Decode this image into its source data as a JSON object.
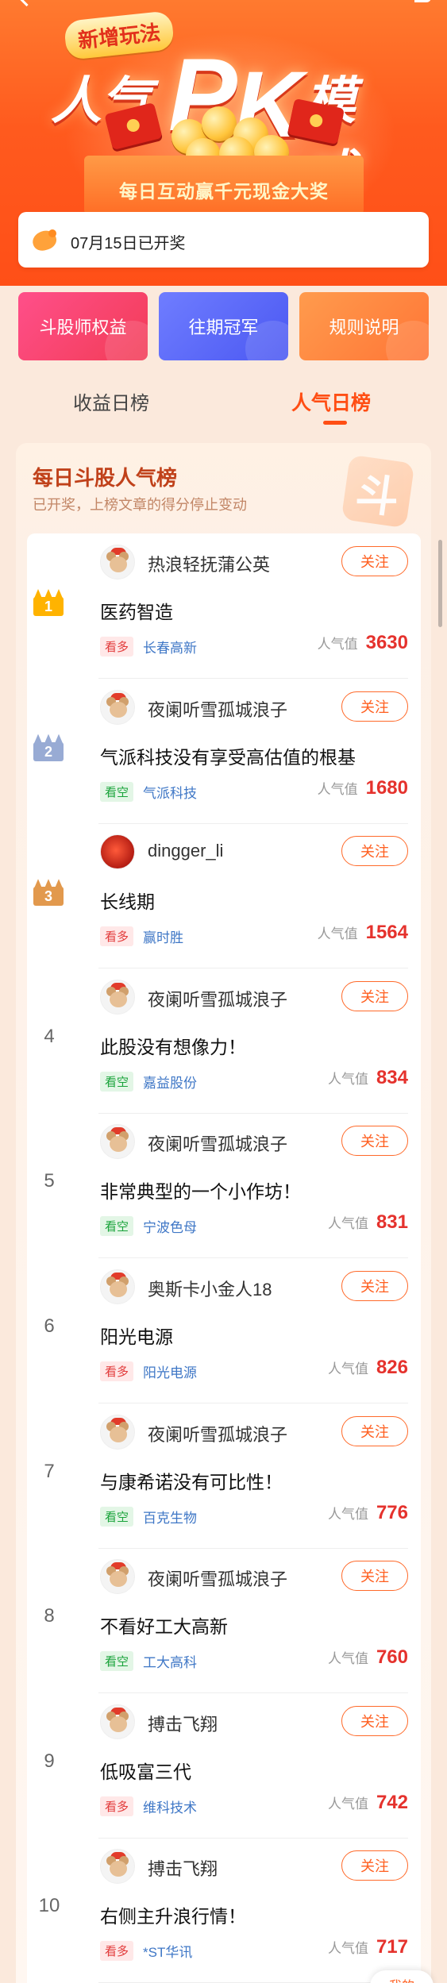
{
  "banner": {
    "badge": "新增玩法",
    "title_pre": "人气",
    "title_p": "P",
    "title_k": "K",
    "title_post": "模式",
    "slogan": "每日互动赢千元现金大奖"
  },
  "notice": {
    "text": "07月15日已开奖",
    "icon": "piggy-icon"
  },
  "buttons": [
    {
      "label": "斗股师权益",
      "color": "#f23c56"
    },
    {
      "label": "往期冠军",
      "color": "#4b58f2"
    },
    {
      "label": "规则说明",
      "color": "#ff7536"
    }
  ],
  "tabs": [
    {
      "label": "收益日榜",
      "active": false
    },
    {
      "label": "人气日榜",
      "active": true
    }
  ],
  "card": {
    "title": "每日斗股人气榜",
    "subtitle": "已开奖，上榜文章的得分停止变动",
    "mark": "斗"
  },
  "list": [
    {
      "rank": "1",
      "author": "热浪轻抚蒲公英",
      "follow": "关注",
      "title": "医药智造",
      "tag": "看多",
      "stock": "长春高新",
      "pop_label": "人气值",
      "pop": "3630"
    },
    {
      "rank": "2",
      "author": "夜阑听雪孤城浪子",
      "follow": "关注",
      "title": "气派科技没有享受高估值的根基",
      "tag": "看空",
      "stock": "气派科技",
      "pop_label": "人气值",
      "pop": "1680"
    },
    {
      "rank": "3",
      "author": "dingger_li",
      "follow": "关注",
      "title": "长线期",
      "tag": "看多",
      "stock": "赢时胜",
      "pop_label": "人气值",
      "pop": "1564"
    },
    {
      "rank": "4",
      "author": "夜阑听雪孤城浪子",
      "follow": "关注",
      "title": "此股没有想像力！",
      "tag": "看空",
      "stock": "嘉益股份",
      "pop_label": "人气值",
      "pop": "834"
    },
    {
      "rank": "5",
      "author": "夜阑听雪孤城浪子",
      "follow": "关注",
      "title": "非常典型的一个小作坊！",
      "tag": "看空",
      "stock": "宁波色母",
      "pop_label": "人气值",
      "pop": "831"
    },
    {
      "rank": "6",
      "author": "奥斯卡小金人18",
      "follow": "关注",
      "title": "阳光电源",
      "tag": "看多",
      "stock": "阳光电源",
      "pop_label": "人气值",
      "pop": "826"
    },
    {
      "rank": "7",
      "author": "夜阑听雪孤城浪子",
      "follow": "关注",
      "title": "与康希诺没有可比性！",
      "tag": "看空",
      "stock": "百克生物",
      "pop_label": "人气值",
      "pop": "776"
    },
    {
      "rank": "8",
      "author": "夜阑听雪孤城浪子",
      "follow": "关注",
      "title": "不看好工大高新",
      "tag": "看空",
      "stock": "工大高科",
      "pop_label": "人气值",
      "pop": "760"
    },
    {
      "rank": "9",
      "author": "搏击飞翔",
      "follow": "关注",
      "title": "低吸富三代",
      "tag": "看多",
      "stock": "维科技术",
      "pop_label": "人气值",
      "pop": "742"
    },
    {
      "rank": "10",
      "author": "搏击飞翔",
      "follow": "关注",
      "title": "右侧主升浪行情！",
      "tag": "看多",
      "stock": "*ST华讯",
      "pop_label": "人气值",
      "pop": "717"
    }
  ],
  "fab": {
    "label": "我的"
  }
}
